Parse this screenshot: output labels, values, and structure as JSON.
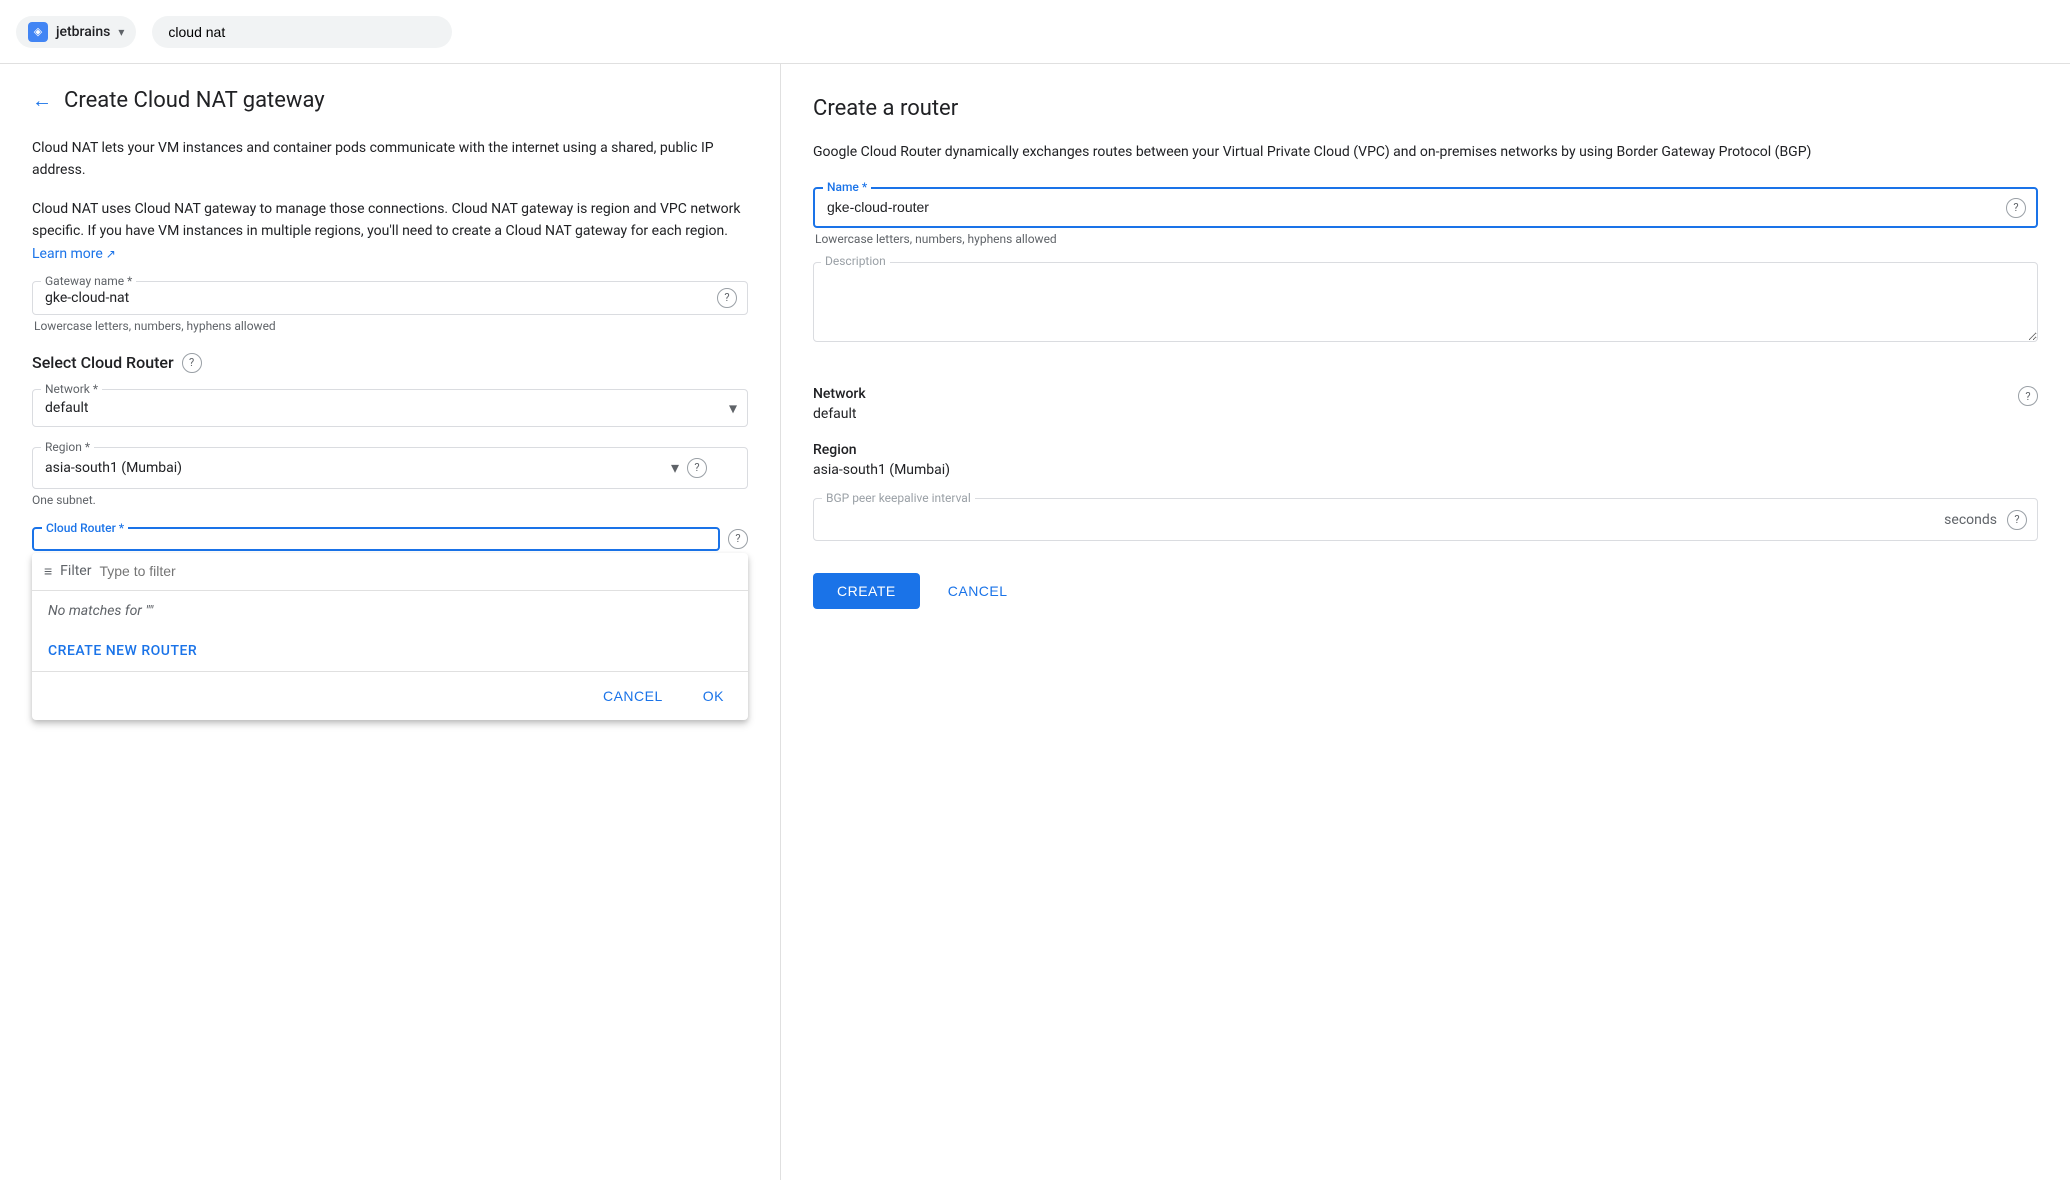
{
  "topbar": {
    "org_name": "jetbrains",
    "org_icon": "◈",
    "search_placeholder": "cloud nat",
    "arrow": "▾"
  },
  "left_panel": {
    "back_label": "←",
    "page_title": "Create Cloud NAT gateway",
    "description_p1": "Cloud NAT lets your VM instances and container pods communicate with the internet using a shared, public IP address.",
    "description_p2": "Cloud NAT uses Cloud NAT gateway to manage those connections. Cloud NAT gateway is region and VPC network specific. If you have VM instances in multiple regions, you'll need to create a Cloud NAT gateway for each region.",
    "learn_more": "Learn more",
    "gateway_name": {
      "label": "Gateway name *",
      "value": "gke-cloud-nat",
      "hint": "Lowercase letters, numbers, hyphens allowed",
      "help": "?"
    },
    "select_cloud_router": {
      "section_title": "Select Cloud Router",
      "help": "?",
      "network": {
        "label": "Network *",
        "value": "default",
        "arrow": "▾"
      },
      "region": {
        "label": "Region *",
        "value": "asia-south1 (Mumbai)",
        "arrow": "▾",
        "help": "?",
        "hint": "One subnet."
      },
      "cloud_router": {
        "label": "Cloud Router *",
        "help": "?"
      },
      "dropdown_popup": {
        "filter_label": "Filter",
        "filter_placeholder": "Type to filter",
        "no_matches": "No matches for \"\"",
        "create_new": "CREATE NEW ROUTER",
        "cancel": "CANCEL",
        "ok": "OK"
      }
    },
    "nat_ip_section": {
      "help": "?"
    }
  },
  "right_panel": {
    "title": "Create a router",
    "description": "Google Cloud Router dynamically exchanges routes between your Virtual Private Cloud (VPC) and on-premises networks by using Border Gateway Protocol (BGP)",
    "name_field": {
      "label": "Name *",
      "value": "gke-cloud-router",
      "hint": "Lowercase letters, numbers, hyphens allowed",
      "help": "?"
    },
    "description_field": {
      "label": "Description",
      "placeholder": ""
    },
    "network": {
      "label": "Network",
      "value": "default",
      "help": "?"
    },
    "region": {
      "label": "Region",
      "value": "asia-south1 (Mumbai)"
    },
    "bgp_field": {
      "label": "BGP peer keepalive interval",
      "suffix": "seconds",
      "help": "?"
    },
    "buttons": {
      "create": "CREATE",
      "cancel": "CANCEL"
    }
  }
}
